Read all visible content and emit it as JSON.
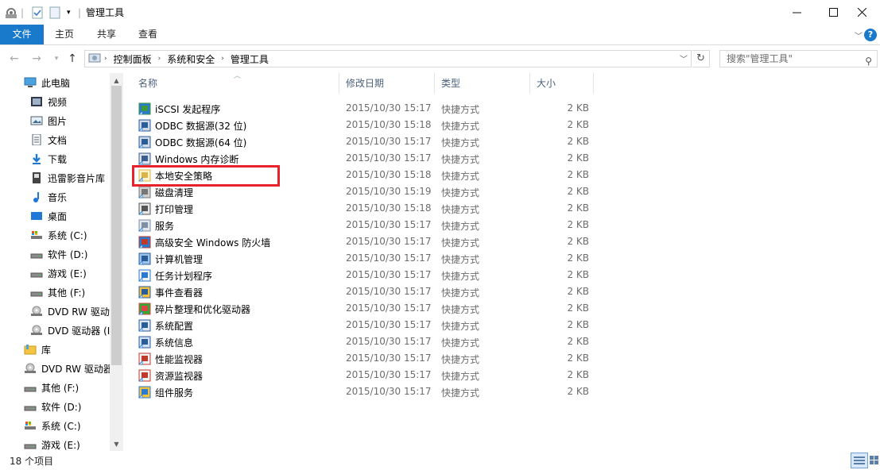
{
  "title": "管理工具",
  "ribbon": {
    "tabs": [
      "文件",
      "主页",
      "共享",
      "查看"
    ]
  },
  "address": {
    "segments": [
      "控制面板",
      "系统和安全",
      "管理工具"
    ],
    "search_placeholder": "搜索\"管理工具\""
  },
  "sidebar": {
    "items": [
      {
        "label": "此电脑",
        "icon": "computer-icon"
      },
      {
        "label": "视频",
        "icon": "video-folder-icon"
      },
      {
        "label": "图片",
        "icon": "pictures-folder-icon"
      },
      {
        "label": "文档",
        "icon": "documents-folder-icon"
      },
      {
        "label": "下载",
        "icon": "download-folder-icon"
      },
      {
        "label": "迅雷影音片库",
        "icon": "media-library-icon"
      },
      {
        "label": "音乐",
        "icon": "music-folder-icon"
      },
      {
        "label": "桌面",
        "icon": "desktop-folder-icon"
      },
      {
        "label": "系统 (C:)",
        "icon": "system-drive-icon"
      },
      {
        "label": "软件 (D:)",
        "icon": "drive-icon"
      },
      {
        "label": "游戏 (E:)",
        "icon": "drive-icon"
      },
      {
        "label": "其他 (F:)",
        "icon": "drive-icon"
      },
      {
        "label": "DVD RW 驱动",
        "icon": "dvd-drive-icon"
      },
      {
        "label": "DVD 驱动器 (I",
        "icon": "dvd-drive-icon"
      },
      {
        "label": "库",
        "icon": "library-icon"
      },
      {
        "label": "DVD RW 驱动器",
        "icon": "dvd-drive-icon"
      },
      {
        "label": "其他 (F:)",
        "icon": "drive-icon"
      },
      {
        "label": "软件 (D:)",
        "icon": "drive-icon"
      },
      {
        "label": "系统 (C:)",
        "icon": "system-drive-icon"
      },
      {
        "label": "游戏 (E:)",
        "icon": "drive-icon"
      }
    ]
  },
  "columns": {
    "name": "名称",
    "date": "修改日期",
    "type": "类型",
    "size": "大小"
  },
  "files": [
    {
      "name": "iSCSI 发起程序",
      "date": "2015/10/30 15:17",
      "type": "快捷方式",
      "size": "2 KB",
      "icon": "iscsi-icon"
    },
    {
      "name": "ODBC 数据源(32 位)",
      "date": "2015/10/30 15:18",
      "type": "快捷方式",
      "size": "2 KB",
      "icon": "odbc-icon"
    },
    {
      "name": "ODBC 数据源(64 位)",
      "date": "2015/10/30 15:17",
      "type": "快捷方式",
      "size": "2 KB",
      "icon": "odbc-icon"
    },
    {
      "name": "Windows 内存诊断",
      "date": "2015/10/30 15:17",
      "type": "快捷方式",
      "size": "2 KB",
      "icon": "memory-diagnostic-icon"
    },
    {
      "name": "本地安全策略",
      "date": "2015/10/30 15:18",
      "type": "快捷方式",
      "size": "2 KB",
      "icon": "security-policy-icon"
    },
    {
      "name": "磁盘清理",
      "date": "2015/10/30 15:19",
      "type": "快捷方式",
      "size": "2 KB",
      "icon": "disk-cleanup-icon"
    },
    {
      "name": "打印管理",
      "date": "2015/10/30 15:18",
      "type": "快捷方式",
      "size": "2 KB",
      "icon": "printer-icon"
    },
    {
      "name": "服务",
      "date": "2015/10/30 15:17",
      "type": "快捷方式",
      "size": "2 KB",
      "icon": "services-icon"
    },
    {
      "name": "高级安全 Windows 防火墙",
      "date": "2015/10/30 15:17",
      "type": "快捷方式",
      "size": "2 KB",
      "icon": "firewall-icon"
    },
    {
      "name": "计算机管理",
      "date": "2015/10/30 15:17",
      "type": "快捷方式",
      "size": "2 KB",
      "icon": "computer-management-icon"
    },
    {
      "name": "任务计划程序",
      "date": "2015/10/30 15:17",
      "type": "快捷方式",
      "size": "2 KB",
      "icon": "task-scheduler-icon"
    },
    {
      "name": "事件查看器",
      "date": "2015/10/30 15:17",
      "type": "快捷方式",
      "size": "2 KB",
      "icon": "event-viewer-icon"
    },
    {
      "name": "碎片整理和优化驱动器",
      "date": "2015/10/30 15:17",
      "type": "快捷方式",
      "size": "2 KB",
      "icon": "defrag-icon"
    },
    {
      "name": "系统配置",
      "date": "2015/10/30 15:17",
      "type": "快捷方式",
      "size": "2 KB",
      "icon": "system-config-icon"
    },
    {
      "name": "系统信息",
      "date": "2015/10/30 15:17",
      "type": "快捷方式",
      "size": "2 KB",
      "icon": "system-info-icon"
    },
    {
      "name": "性能监视器",
      "date": "2015/10/30 15:17",
      "type": "快捷方式",
      "size": "2 KB",
      "icon": "performance-monitor-icon"
    },
    {
      "name": "资源监视器",
      "date": "2015/10/30 15:17",
      "type": "快捷方式",
      "size": "2 KB",
      "icon": "resource-monitor-icon"
    },
    {
      "name": "组件服务",
      "date": "2015/10/30 15:17",
      "type": "快捷方式",
      "size": "2 KB",
      "icon": "component-services-icon"
    }
  ],
  "status": {
    "count": "18 个项目"
  },
  "colors": {
    "accent": "#1979ca",
    "highlight": "#e8212b",
    "header_text": "#4c607a",
    "meta_text": "#6d6d6d"
  }
}
